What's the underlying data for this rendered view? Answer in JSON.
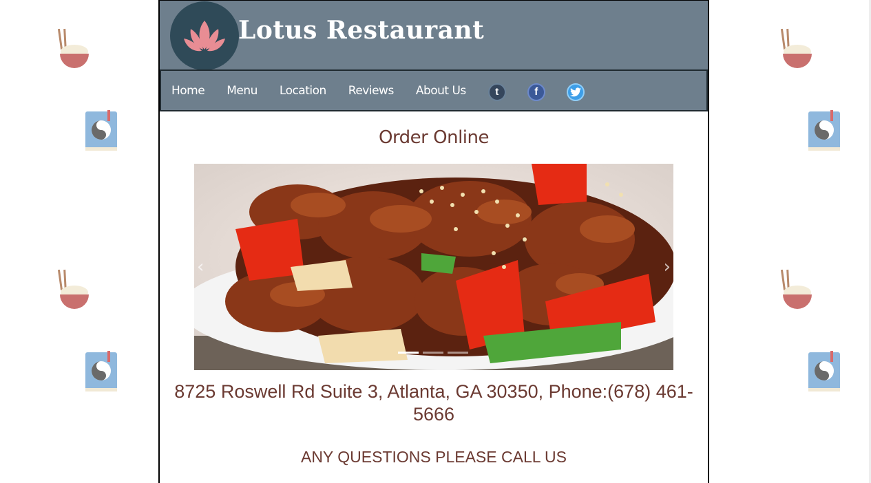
{
  "brand": {
    "name": "Lotus Restaurant"
  },
  "nav": {
    "items": [
      "Home",
      "Menu",
      "Location",
      "Reviews",
      "About Us"
    ],
    "social": [
      {
        "icon": "tumblr-icon",
        "glyph": "t"
      },
      {
        "icon": "facebook-icon",
        "glyph": "f"
      },
      {
        "icon": "twitter-icon",
        "glyph": ""
      }
    ]
  },
  "main": {
    "order_title": "Order Online",
    "carousel": {
      "image": "sweet-and-sour-chicken-photo",
      "arrow_left": "‹",
      "arrow_right": "›",
      "slide_count": 3,
      "active_slide": 1
    },
    "address": "8725 Roswell Rd Suite 3, Atlanta, GA 30350, Phone:(678) 461-5666",
    "questions": "ANY QUESTIONS PLEASE CALL US"
  },
  "decorations": [
    "rice-bowl-chopsticks-icon",
    "yin-yang-book-icon"
  ],
  "colors": {
    "header_bg": "#6e7f8d",
    "logo_bg": "#2f4a58",
    "text_accent": "#6b3a32",
    "lotus": "#e88d94"
  }
}
